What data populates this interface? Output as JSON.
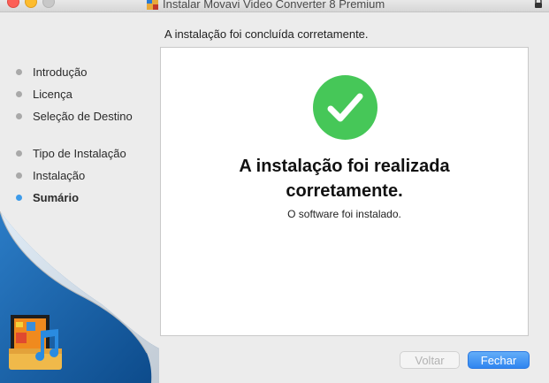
{
  "window": {
    "title": "Instalar Movavi Video Converter 8 Premium"
  },
  "header": {
    "text": "A instalação foi concluída corretamente."
  },
  "sidebar": {
    "steps": [
      {
        "label": "Introdução",
        "active": false
      },
      {
        "label": "Licença",
        "active": false
      },
      {
        "label": "Seleção de Destino",
        "active": false
      },
      {
        "label": "Tipo de Instalação",
        "active": false
      },
      {
        "label": "Instalação",
        "active": false
      },
      {
        "label": "Sumário",
        "active": true
      }
    ]
  },
  "main": {
    "title_line1": "A instalação foi realizada",
    "title_line2": "corretamente.",
    "subtitle": "O software foi instalado."
  },
  "buttons": {
    "back_label": "Voltar",
    "back_enabled": false,
    "close_label": "Fechar"
  },
  "icons": {
    "success": "checkmark-icon",
    "app": "movavi-app-icon",
    "lock": "lock-icon"
  },
  "colors": {
    "success": "#46c758",
    "accent": "#3d9bea",
    "primary_button": "#2f85f0",
    "sidebar_blue": "#1a63a8"
  }
}
